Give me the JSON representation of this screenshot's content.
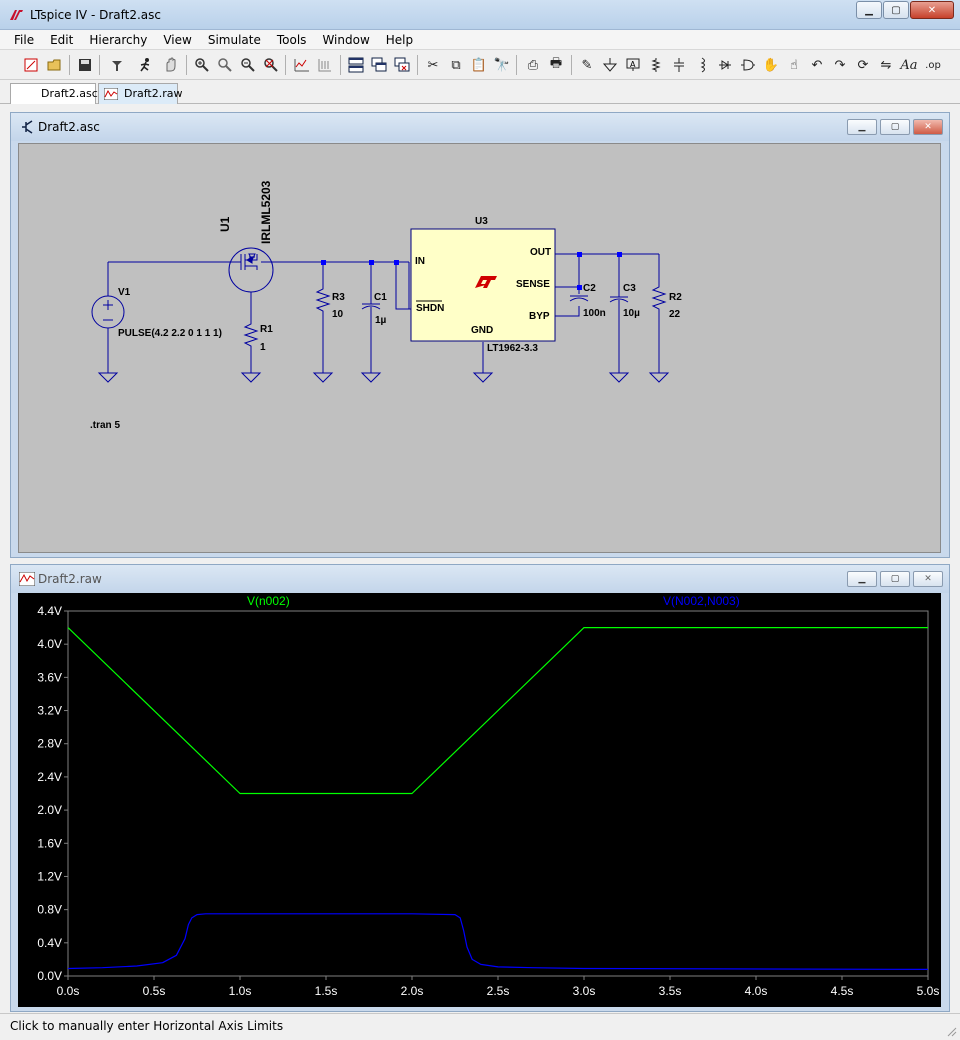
{
  "app": {
    "title": "LTspice IV - Draft2.asc"
  },
  "menu": [
    "File",
    "Edit",
    "Hierarchy",
    "View",
    "Simulate",
    "Tools",
    "Window",
    "Help"
  ],
  "toolbar_icons": [
    "new-schematic-icon",
    "open-icon",
    "save-icon",
    "control-panel-icon",
    "run-icon",
    "halt-icon",
    "zoom-in-icon",
    "zoom-pan-icon",
    "zoom-out-icon",
    "zoom-fit-icon",
    "autorange-icon",
    "grid-icon",
    "tile-icon",
    "cascade-icon",
    "close-all-icon",
    "cut-icon",
    "copy-icon",
    "paste-icon",
    "find-icon",
    "print-setup-icon",
    "print-icon",
    "draw-wire-icon",
    "ground-icon",
    "label-icon",
    "resistor-icon",
    "capacitor-icon",
    "inductor-icon",
    "diode-icon",
    "component-icon",
    "move-icon",
    "drag-icon",
    "undo-icon",
    "redo-icon",
    "rotate-icon",
    "mirror-icon",
    "text-icon",
    "spice-directive-icon"
  ],
  "tabs": [
    {
      "label": "Draft2.asc"
    },
    {
      "label": "Draft2.raw"
    }
  ],
  "schematic_window": {
    "title": "Draft2.asc",
    "labels": {
      "v1": "V1",
      "v1_value": "PULSE(4.2 2.2 0 1 1 1)",
      "u1": "U1",
      "u1_part": "IRLML5203",
      "r1": "R1",
      "r1_value": "1",
      "r3": "R3",
      "r3_value": "10",
      "c1": "C1",
      "c1_value": "1µ",
      "u3": "U3",
      "u3_part": "LT1962-3.3",
      "pin_in": "IN",
      "pin_shdn": "SHDN",
      "pin_gnd": "GND",
      "pin_out": "OUT",
      "pin_sense": "SENSE",
      "pin_byp": "BYP",
      "c2": "C2",
      "c2_value": "100n",
      "c3": "C3",
      "c3_value": "10µ",
      "r2": "R2",
      "r2_value": "22",
      "directive": ".tran 5"
    }
  },
  "plot_window": {
    "title": "Draft2.raw",
    "trace1_name": "V(n002)",
    "trace2_name": "V(N002,N003)",
    "colors": {
      "trace1": "#00ff00",
      "trace2": "#0000ff",
      "background": "#000000"
    }
  },
  "chart_data": {
    "type": "line",
    "xlabel": "",
    "ylabel": "",
    "xlim": [
      0,
      5
    ],
    "ylim": [
      0,
      4.4
    ],
    "xticks": [
      "0.0s",
      "0.5s",
      "1.0s",
      "1.5s",
      "2.0s",
      "2.5s",
      "3.0s",
      "3.5s",
      "4.0s",
      "4.5s",
      "5.0s"
    ],
    "yticks": [
      "0.0V",
      "0.4V",
      "0.8V",
      "1.2V",
      "1.6V",
      "2.0V",
      "2.4V",
      "2.8V",
      "3.2V",
      "3.6V",
      "4.0V",
      "4.4V"
    ],
    "grid": false,
    "series": [
      {
        "name": "V(n002)",
        "x": [
          0,
          1,
          2,
          3,
          5
        ],
        "y": [
          4.2,
          2.2,
          2.2,
          4.2,
          4.2
        ]
      },
      {
        "name": "V(N002,N003)",
        "x": [
          0,
          0.2,
          0.4,
          0.55,
          0.63,
          0.68,
          0.7,
          0.72,
          0.75,
          0.8,
          1.0,
          2.0,
          2.25,
          2.28,
          2.3,
          2.32,
          2.35,
          2.4,
          2.5,
          2.7,
          3.0,
          5.0
        ],
        "y": [
          0.09,
          0.1,
          0.12,
          0.16,
          0.25,
          0.45,
          0.62,
          0.7,
          0.74,
          0.75,
          0.75,
          0.75,
          0.74,
          0.7,
          0.55,
          0.35,
          0.2,
          0.14,
          0.11,
          0.1,
          0.09,
          0.08
        ]
      }
    ]
  },
  "status": {
    "text": "Click to manually enter Horizontal Axis Limits"
  }
}
